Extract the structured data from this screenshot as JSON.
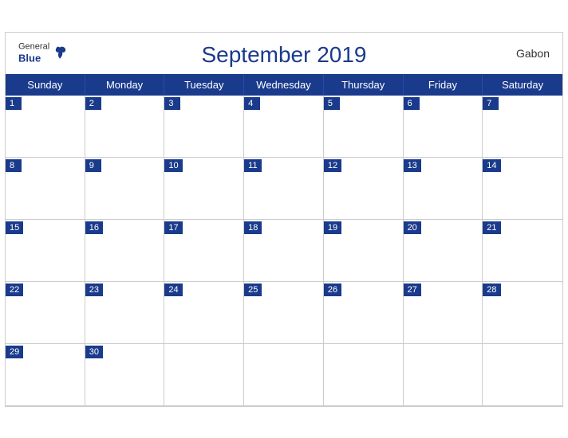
{
  "header": {
    "title": "September 2019",
    "logo_general": "General",
    "logo_blue": "Blue",
    "country": "Gabon"
  },
  "days_of_week": [
    "Sunday",
    "Monday",
    "Tuesday",
    "Wednesday",
    "Thursday",
    "Friday",
    "Saturday"
  ],
  "weeks": [
    [
      {
        "num": "1",
        "empty": false
      },
      {
        "num": "2",
        "empty": false
      },
      {
        "num": "3",
        "empty": false
      },
      {
        "num": "4",
        "empty": false
      },
      {
        "num": "5",
        "empty": false
      },
      {
        "num": "6",
        "empty": false
      },
      {
        "num": "7",
        "empty": false
      }
    ],
    [
      {
        "num": "8",
        "empty": false
      },
      {
        "num": "9",
        "empty": false
      },
      {
        "num": "10",
        "empty": false
      },
      {
        "num": "11",
        "empty": false
      },
      {
        "num": "12",
        "empty": false
      },
      {
        "num": "13",
        "empty": false
      },
      {
        "num": "14",
        "empty": false
      }
    ],
    [
      {
        "num": "15",
        "empty": false
      },
      {
        "num": "16",
        "empty": false
      },
      {
        "num": "17",
        "empty": false
      },
      {
        "num": "18",
        "empty": false
      },
      {
        "num": "19",
        "empty": false
      },
      {
        "num": "20",
        "empty": false
      },
      {
        "num": "21",
        "empty": false
      }
    ],
    [
      {
        "num": "22",
        "empty": false
      },
      {
        "num": "23",
        "empty": false
      },
      {
        "num": "24",
        "empty": false
      },
      {
        "num": "25",
        "empty": false
      },
      {
        "num": "26",
        "empty": false
      },
      {
        "num": "27",
        "empty": false
      },
      {
        "num": "28",
        "empty": false
      }
    ],
    [
      {
        "num": "29",
        "empty": false
      },
      {
        "num": "30",
        "empty": false
      },
      {
        "num": "",
        "empty": true
      },
      {
        "num": "",
        "empty": true
      },
      {
        "num": "",
        "empty": true
      },
      {
        "num": "",
        "empty": true
      },
      {
        "num": "",
        "empty": true
      }
    ]
  ],
  "colors": {
    "header_blue": "#1a3a8c",
    "border": "#cccccc",
    "text_white": "#ffffff"
  }
}
